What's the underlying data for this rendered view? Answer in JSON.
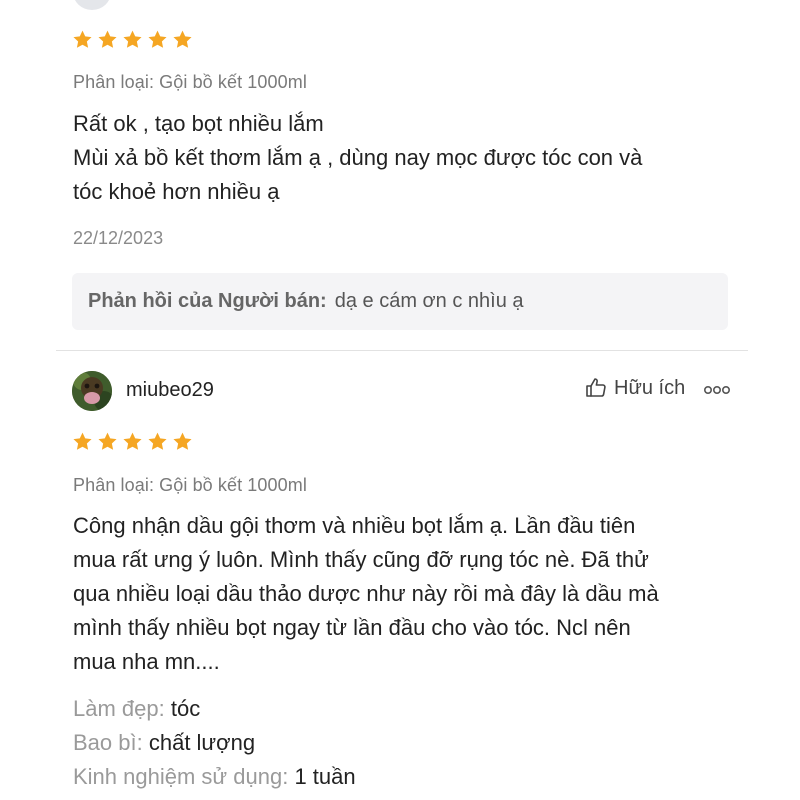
{
  "colors": {
    "star": "#F5A623",
    "muted_text": "#7a7a7a",
    "seller_bg": "#f4f4f6",
    "divider": "#e2e2e2"
  },
  "review1": {
    "rating": 5,
    "variant": "Phân loại: Gội bồ kết 1000ml",
    "text_lines": [
      "Rất ok , tạo bọt nhiều lắm",
      "Mùi xả bồ kết thơm lắm ạ , dùng nay mọc được tóc con và",
      "tóc khoẻ hơn nhiều ạ"
    ],
    "date": "22/12/2023",
    "seller_reply": {
      "label": "Phản hồi của Người bán:",
      "text": "dạ e cám ơn c nhìu ạ"
    }
  },
  "review2": {
    "username": "miubeo29",
    "helpful_label": "Hữu ích",
    "helpful_icon": "thumbs-up-icon",
    "more_icon": "more-options-icon",
    "rating": 5,
    "variant": "Phân loại: Gội bồ kết 1000ml",
    "text_lines": [
      "Công nhận dầu gội thơm và nhiều bọt lắm ạ. Lần đầu tiên",
      "mua rất ưng ý luôn. Mình thấy cũng đỡ rụng tóc nè. Đã thử",
      "qua nhiều loại dầu thảo dược như này rồi mà đây là dầu mà",
      "mình thấy nhiều bọt ngay từ lần đầu cho vào tóc. Ncl nên",
      "mua nha mn...."
    ],
    "attributes": [
      {
        "key": "Làm đẹp:",
        "value": "tóc"
      },
      {
        "key": "Bao bì:",
        "value": "chất lượng"
      },
      {
        "key": "Kinh nghiệm sử dụng:",
        "value": "1 tuần"
      }
    ]
  }
}
